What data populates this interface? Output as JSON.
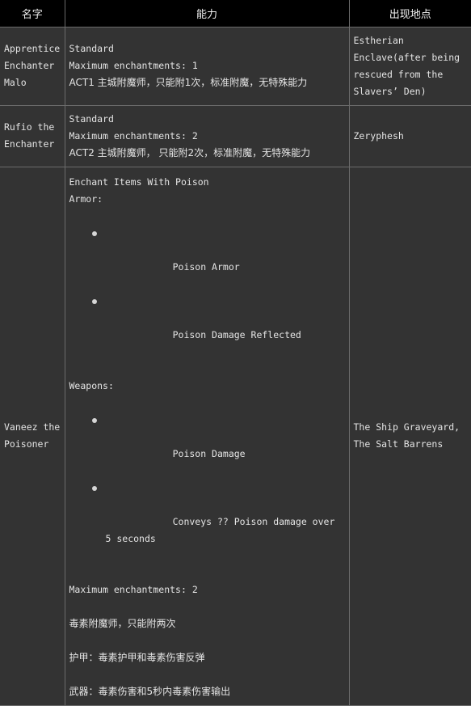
{
  "table": {
    "headers": [
      {
        "label": "名字",
        "key": "name"
      },
      {
        "label": "能力",
        "key": "power"
      },
      {
        "label": "出现地点",
        "key": "place"
      }
    ],
    "rows": [
      {
        "name": "Apprentice Enchanter Malo",
        "power_lines": [
          "Standard",
          "Maximum enchantments: 1",
          "ACT1 主城附魔师，只能附1次，标准附魔，无特殊能力"
        ],
        "place": "Estherian Enclave(after being rescued from the Slavers’ Den)"
      },
      {
        "name": "Rufio the Enchanter",
        "power_lines": [
          "Standard",
          "Maximum enchantments: 2",
          "ACT2 主城附魔师， 只能附2次，标准附魔，无特殊能力"
        ],
        "place": "Zeryphesh"
      },
      {
        "name": "Vaneez the Poisoner",
        "power_title": "Enchant Items With Poison",
        "armor_label": "Armor:",
        "armor_items": [
          "Poison Armor",
          "Poison Damage Reflected"
        ],
        "weapons_label": "Weapons:",
        "weapons_items": [
          "Poison Damage",
          "Conveys ?? Poison damage over 5 seconds"
        ],
        "max_enchantments": "Maximum enchantments: 2",
        "cn_lines": [
          "毒素附魔师，只能附两次",
          "护甲：毒素护甲和毒素伤害反弹",
          "武器：毒素伤害和5秒内毒素伤害输出"
        ],
        "place": "The Ship Graveyard, The Salt Barrens"
      }
    ]
  },
  "colors": {
    "background": "#333333",
    "header_background": "#000000",
    "border": "#6b6b6b",
    "text": "#e4e4e4",
    "bullet": "#d6d6d6"
  }
}
